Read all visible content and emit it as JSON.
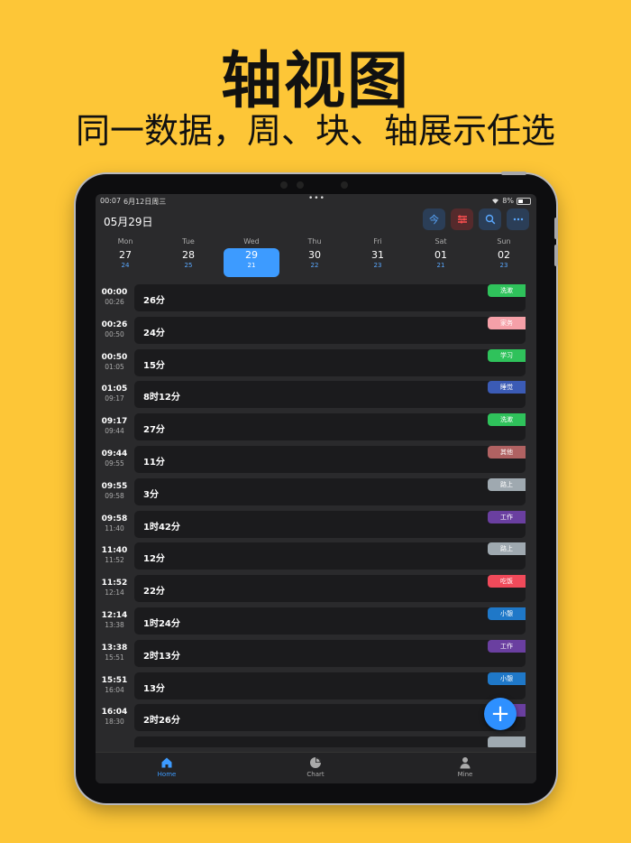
{
  "headline": {
    "title": "轴视图",
    "subtitle": "同一数据，周、块、轴展示任选"
  },
  "status": {
    "time": "00:07",
    "date": "6月12日周三",
    "dots": "•••",
    "battery": "8%"
  },
  "header": {
    "date": "05月29日",
    "today_button": "今",
    "colors": {
      "today": "#5aa8ff",
      "filter": "#ff5050",
      "search": "#5aa8ff",
      "more": "#5aa8ff"
    }
  },
  "week": [
    {
      "name": "Mon",
      "date": "27",
      "sub": "24",
      "selected": false
    },
    {
      "name": "Tue",
      "date": "28",
      "sub": "25",
      "selected": false
    },
    {
      "name": "Wed",
      "date": "29",
      "sub": "21",
      "selected": true
    },
    {
      "name": "Thu",
      "date": "30",
      "sub": "22",
      "selected": false
    },
    {
      "name": "Fri",
      "date": "31",
      "sub": "23",
      "selected": false
    },
    {
      "name": "Sat",
      "date": "01",
      "sub": "21",
      "selected": false
    },
    {
      "name": "Sun",
      "date": "02",
      "sub": "23",
      "selected": false
    }
  ],
  "entries": [
    {
      "start": "00:00",
      "end": "00:26",
      "duration": "26分",
      "tag": "洗漱",
      "color": "#2fc25b"
    },
    {
      "start": "00:26",
      "end": "00:50",
      "duration": "24分",
      "tag": "家务",
      "color": "#f5a0a8"
    },
    {
      "start": "00:50",
      "end": "01:05",
      "duration": "15分",
      "tag": "学习",
      "color": "#2fc25b"
    },
    {
      "start": "01:05",
      "end": "09:17",
      "duration": "8时12分",
      "tag": "睡觉",
      "color": "#3b5bb5"
    },
    {
      "start": "09:17",
      "end": "09:44",
      "duration": "27分",
      "tag": "洗漱",
      "color": "#2fc25b"
    },
    {
      "start": "09:44",
      "end": "09:55",
      "duration": "11分",
      "tag": "其他",
      "color": "#b06262"
    },
    {
      "start": "09:55",
      "end": "09:58",
      "duration": "3分",
      "tag": "路上",
      "color": "#9fa9b0"
    },
    {
      "start": "09:58",
      "end": "11:40",
      "duration": "1时42分",
      "tag": "工作",
      "color": "#6a3fa0"
    },
    {
      "start": "11:40",
      "end": "11:52",
      "duration": "12分",
      "tag": "路上",
      "color": "#9fa9b0"
    },
    {
      "start": "11:52",
      "end": "12:14",
      "duration": "22分",
      "tag": "吃饭",
      "color": "#f04a5a"
    },
    {
      "start": "12:14",
      "end": "13:38",
      "duration": "1时24分",
      "tag": "小憩",
      "color": "#1f78c8"
    },
    {
      "start": "13:38",
      "end": "15:51",
      "duration": "2时13分",
      "tag": "工作",
      "color": "#6a3fa0"
    },
    {
      "start": "15:51",
      "end": "16:04",
      "duration": "13分",
      "tag": "小憩",
      "color": "#1f78c8"
    },
    {
      "start": "16:04",
      "end": "18:30",
      "duration": "2时26分",
      "tag": "",
      "color": "#6a3fa0"
    },
    {
      "start": "",
      "end": "",
      "duration": "",
      "tag": "",
      "color": "#9fa9b0"
    }
  ],
  "fab": {
    "label": "+"
  },
  "tabs": [
    {
      "label": "Home",
      "icon": "home-icon",
      "active": true
    },
    {
      "label": "Chart",
      "icon": "pie-chart-icon",
      "active": false
    },
    {
      "label": "Mine",
      "icon": "person-icon",
      "active": false
    }
  ]
}
